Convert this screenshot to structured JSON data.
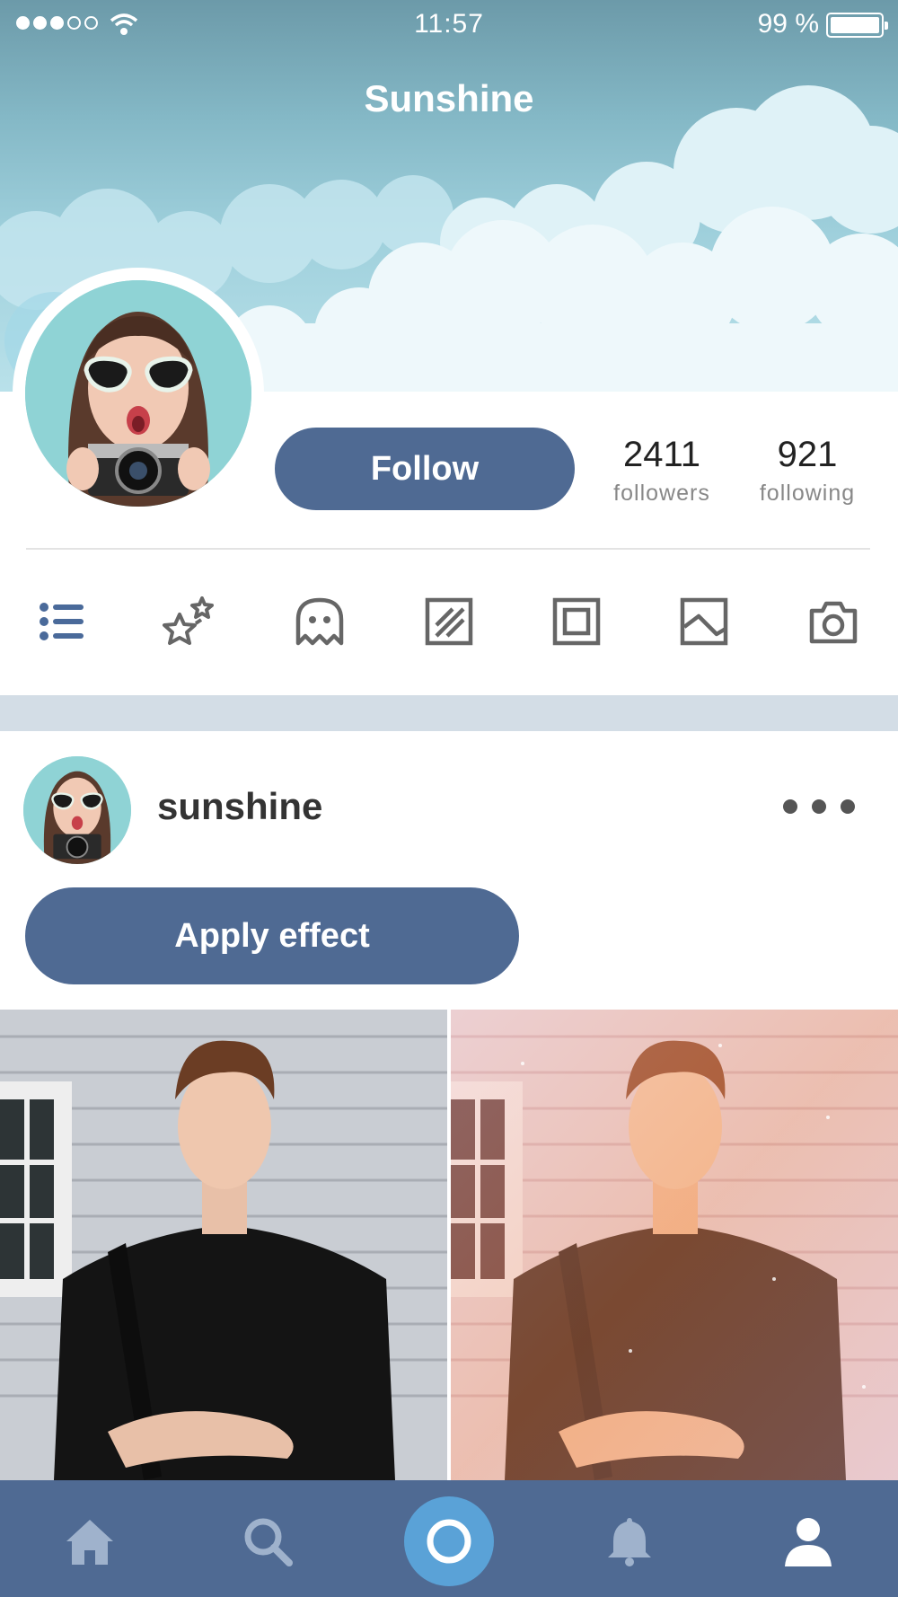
{
  "status_bar": {
    "time": "11:57",
    "battery": "99 %"
  },
  "header": {
    "title": "Sunshine"
  },
  "profile": {
    "follow_label": "Follow",
    "followers_count": "2411",
    "followers_label": "followers",
    "following_count": "921",
    "following_label": "following"
  },
  "filter_icons": [
    "list-icon",
    "sparkle-stars-icon",
    "ghost-icon",
    "slash-square-icon",
    "frame-icon",
    "image-icon",
    "camera-icon"
  ],
  "post": {
    "username": "sunshine",
    "apply_label": "Apply effect"
  },
  "tab_bar": {
    "items": [
      "home-icon",
      "search-icon",
      "record-icon",
      "bell-icon",
      "profile-icon"
    ],
    "active": "profile-icon"
  },
  "colors": {
    "accent": "#4f6a93",
    "tab_center": "#5aa2d7",
    "active_filter": "#4a6a9a"
  }
}
